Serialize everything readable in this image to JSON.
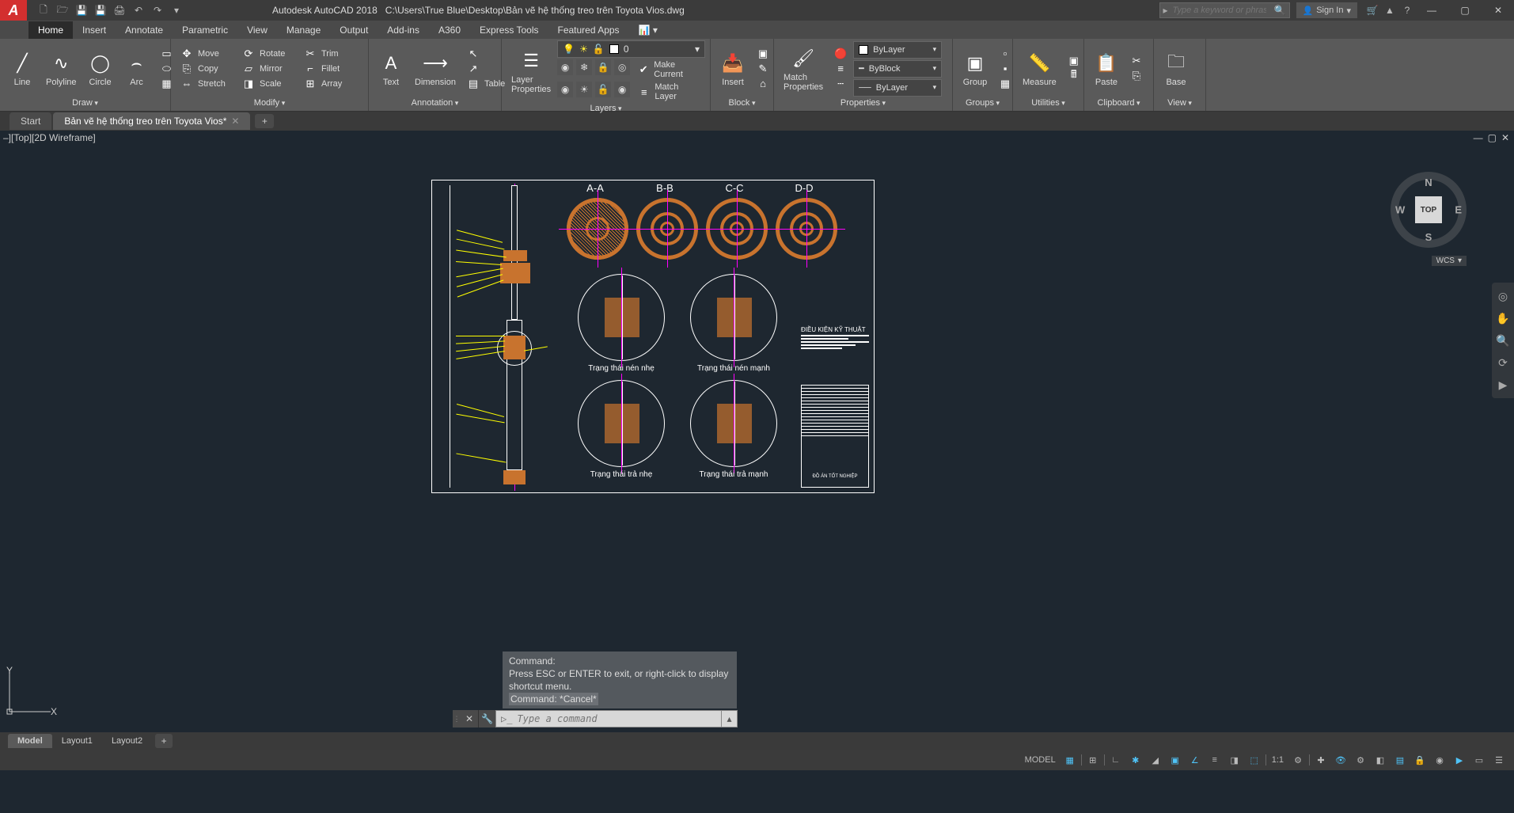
{
  "titlebar": {
    "app_name": "Autodesk AutoCAD 2018",
    "file_path": "C:\\Users\\True Blue\\Desktop\\Bản vẽ hệ thống treo trên Toyota Vios.dwg",
    "search_placeholder": "Type a keyword or phrase",
    "signin_label": "Sign In"
  },
  "ribbon_tabs": [
    "Home",
    "Insert",
    "Annotate",
    "Parametric",
    "View",
    "Manage",
    "Output",
    "Add-ins",
    "A360",
    "Express Tools",
    "Featured Apps"
  ],
  "ribbon": {
    "draw": {
      "title": "Draw",
      "line": "Line",
      "polyline": "Polyline",
      "circle": "Circle",
      "arc": "Arc"
    },
    "modify": {
      "title": "Modify",
      "move": "Move",
      "rotate": "Rotate",
      "trim": "Trim",
      "copy": "Copy",
      "mirror": "Mirror",
      "fillet": "Fillet",
      "stretch": "Stretch",
      "scale": "Scale",
      "array": "Array"
    },
    "annotation": {
      "title": "Annotation",
      "text": "Text",
      "dimension": "Dimension",
      "table": "Table"
    },
    "layers": {
      "title": "Layers",
      "properties": "Layer\nProperties",
      "current_layer": "0",
      "make_current": "Make Current",
      "match_layer": "Match Layer"
    },
    "block": {
      "title": "Block",
      "insert": "Insert"
    },
    "properties": {
      "title": "Properties",
      "match": "Match\nProperties",
      "color": "ByLayer",
      "linetype": "ByLayer",
      "lineweight": "ByBlock"
    },
    "groups": {
      "title": "Groups",
      "group": "Group"
    },
    "utilities": {
      "title": "Utilities",
      "measure": "Measure"
    },
    "clipboard": {
      "title": "Clipboard",
      "paste": "Paste"
    },
    "view": {
      "title": "View",
      "base": "Base"
    }
  },
  "file_tabs": {
    "start": "Start",
    "active": "Bản vẽ hệ thống treo trên Toyota Vios*"
  },
  "viewport": {
    "label": "–][Top][2D Wireframe]"
  },
  "viewcube": {
    "face": "TOP",
    "n": "N",
    "s": "S",
    "e": "E",
    "w": "W",
    "wcs": "WCS"
  },
  "drawing": {
    "sections": [
      "A-A",
      "B-B",
      "C-C",
      "D-D"
    ],
    "details": [
      "Trạng thái nén nhẹ",
      "Trạng thái nén mạnh",
      "Trạng thái trả nhẹ",
      "Trạng thái trả mạnh"
    ],
    "note_title": "ĐIỀU KIỆN KỸ THUẬT",
    "title_block": "ĐỒ ÁN TỐT NGHIỆP",
    "ucs_x": "X",
    "ucs_y": "Y"
  },
  "command": {
    "hist1": "Command:",
    "hist2": "Press ESC or ENTER to exit, or right-click to display shortcut menu.",
    "hist3": "Command: *Cancel*",
    "placeholder": "Type a command"
  },
  "layout_tabs": [
    "Model",
    "Layout1",
    "Layout2"
  ],
  "status": {
    "model": "MODEL",
    "scale": "1:1"
  }
}
